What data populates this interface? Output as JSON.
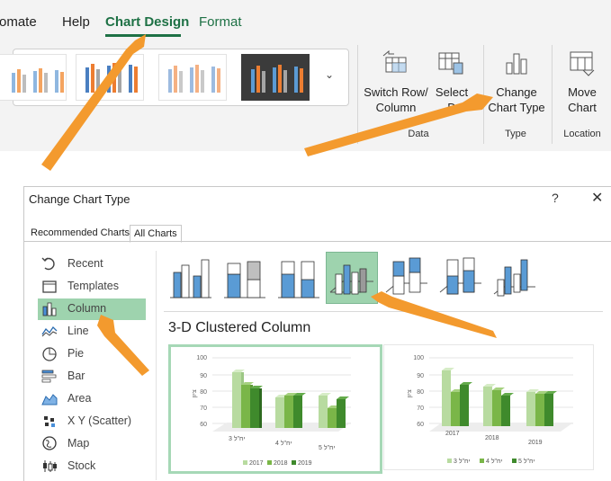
{
  "ribbon": {
    "tabs": [
      {
        "label": "omate"
      },
      {
        "label": "Help"
      },
      {
        "label": "Chart Design"
      },
      {
        "label": "Format"
      }
    ],
    "switch_row_column": {
      "line1": "Switch Row/",
      "line2": "Column"
    },
    "select_data": {
      "line1": "Select",
      "line2": "D"
    },
    "change_chart_type": {
      "line1": "Change",
      "line2": "Chart Type"
    },
    "move_chart": {
      "line1": "Move",
      "line2": "Chart"
    },
    "groups": {
      "data": "Data",
      "type": "Type",
      "location": "Location"
    }
  },
  "dialog": {
    "title": "Change Chart Type",
    "help": "?",
    "close": "✕",
    "tabs": {
      "recommended": "Recommended Charts",
      "all": "All Charts"
    },
    "categories": [
      {
        "label": "Recent",
        "icon": "recent-icon"
      },
      {
        "label": "Templates",
        "icon": "templates-icon"
      },
      {
        "label": "Column",
        "icon": "column-chart-icon"
      },
      {
        "label": "Line",
        "icon": "line-chart-icon"
      },
      {
        "label": "Pie",
        "icon": "pie-chart-icon"
      },
      {
        "label": "Bar",
        "icon": "bar-chart-icon"
      },
      {
        "label": "Area",
        "icon": "area-chart-icon"
      },
      {
        "label": "X Y (Scatter)",
        "icon": "scatter-chart-icon"
      },
      {
        "label": "Map",
        "icon": "map-chart-icon"
      },
      {
        "label": "Stock",
        "icon": "stock-chart-icon"
      }
    ],
    "selected_category": "Column",
    "subtype_title": "3-D Clustered Column",
    "previews": [
      {
        "y_ticks": [
          "100",
          "90",
          "80",
          "70",
          "60"
        ],
        "y_axis_label": "ציון",
        "categories": [
          "יח\"ל 3",
          "יח\"ל 4",
          "יח\"ל 5"
        ],
        "legend": [
          "2017",
          "2018",
          "2019"
        ]
      },
      {
        "y_ticks": [
          "100",
          "90",
          "80",
          "70",
          "60"
        ],
        "y_axis_label": "ציון",
        "categories": [
          "2017",
          "2018",
          "2019"
        ],
        "legend": [
          "יח\"ל 3",
          "יח\"ל 4",
          "יח\"ל 5"
        ]
      }
    ]
  },
  "colors": {
    "accent_green": "#1e7145",
    "selection_green": "#9ed3ae",
    "annotation_arrow": "#f39a2e",
    "series_light": "#b8dba0",
    "series_mid": "#7ab648",
    "series_dark": "#3f8a2c"
  }
}
